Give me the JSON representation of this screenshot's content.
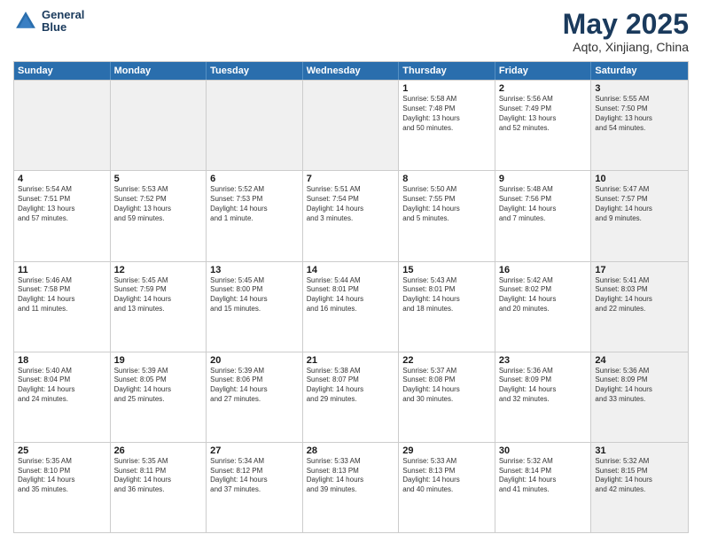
{
  "logo": {
    "line1": "General",
    "line2": "Blue"
  },
  "title": "May 2025",
  "location": "Aqto, Xinjiang, China",
  "headers": [
    "Sunday",
    "Monday",
    "Tuesday",
    "Wednesday",
    "Thursday",
    "Friday",
    "Saturday"
  ],
  "weeks": [
    [
      {
        "day": "",
        "text": "",
        "shaded": true
      },
      {
        "day": "",
        "text": "",
        "shaded": true
      },
      {
        "day": "",
        "text": "",
        "shaded": true
      },
      {
        "day": "",
        "text": "",
        "shaded": true
      },
      {
        "day": "1",
        "text": "Sunrise: 5:58 AM\nSunset: 7:48 PM\nDaylight: 13 hours\nand 50 minutes."
      },
      {
        "day": "2",
        "text": "Sunrise: 5:56 AM\nSunset: 7:49 PM\nDaylight: 13 hours\nand 52 minutes."
      },
      {
        "day": "3",
        "text": "Sunrise: 5:55 AM\nSunset: 7:50 PM\nDaylight: 13 hours\nand 54 minutes.",
        "shaded": true
      }
    ],
    [
      {
        "day": "4",
        "text": "Sunrise: 5:54 AM\nSunset: 7:51 PM\nDaylight: 13 hours\nand 57 minutes."
      },
      {
        "day": "5",
        "text": "Sunrise: 5:53 AM\nSunset: 7:52 PM\nDaylight: 13 hours\nand 59 minutes."
      },
      {
        "day": "6",
        "text": "Sunrise: 5:52 AM\nSunset: 7:53 PM\nDaylight: 14 hours\nand 1 minute."
      },
      {
        "day": "7",
        "text": "Sunrise: 5:51 AM\nSunset: 7:54 PM\nDaylight: 14 hours\nand 3 minutes."
      },
      {
        "day": "8",
        "text": "Sunrise: 5:50 AM\nSunset: 7:55 PM\nDaylight: 14 hours\nand 5 minutes."
      },
      {
        "day": "9",
        "text": "Sunrise: 5:48 AM\nSunset: 7:56 PM\nDaylight: 14 hours\nand 7 minutes."
      },
      {
        "day": "10",
        "text": "Sunrise: 5:47 AM\nSunset: 7:57 PM\nDaylight: 14 hours\nand 9 minutes.",
        "shaded": true
      }
    ],
    [
      {
        "day": "11",
        "text": "Sunrise: 5:46 AM\nSunset: 7:58 PM\nDaylight: 14 hours\nand 11 minutes."
      },
      {
        "day": "12",
        "text": "Sunrise: 5:45 AM\nSunset: 7:59 PM\nDaylight: 14 hours\nand 13 minutes."
      },
      {
        "day": "13",
        "text": "Sunrise: 5:45 AM\nSunset: 8:00 PM\nDaylight: 14 hours\nand 15 minutes."
      },
      {
        "day": "14",
        "text": "Sunrise: 5:44 AM\nSunset: 8:01 PM\nDaylight: 14 hours\nand 16 minutes."
      },
      {
        "day": "15",
        "text": "Sunrise: 5:43 AM\nSunset: 8:01 PM\nDaylight: 14 hours\nand 18 minutes."
      },
      {
        "day": "16",
        "text": "Sunrise: 5:42 AM\nSunset: 8:02 PM\nDaylight: 14 hours\nand 20 minutes."
      },
      {
        "day": "17",
        "text": "Sunrise: 5:41 AM\nSunset: 8:03 PM\nDaylight: 14 hours\nand 22 minutes.",
        "shaded": true
      }
    ],
    [
      {
        "day": "18",
        "text": "Sunrise: 5:40 AM\nSunset: 8:04 PM\nDaylight: 14 hours\nand 24 minutes."
      },
      {
        "day": "19",
        "text": "Sunrise: 5:39 AM\nSunset: 8:05 PM\nDaylight: 14 hours\nand 25 minutes."
      },
      {
        "day": "20",
        "text": "Sunrise: 5:39 AM\nSunset: 8:06 PM\nDaylight: 14 hours\nand 27 minutes."
      },
      {
        "day": "21",
        "text": "Sunrise: 5:38 AM\nSunset: 8:07 PM\nDaylight: 14 hours\nand 29 minutes."
      },
      {
        "day": "22",
        "text": "Sunrise: 5:37 AM\nSunset: 8:08 PM\nDaylight: 14 hours\nand 30 minutes."
      },
      {
        "day": "23",
        "text": "Sunrise: 5:36 AM\nSunset: 8:09 PM\nDaylight: 14 hours\nand 32 minutes."
      },
      {
        "day": "24",
        "text": "Sunrise: 5:36 AM\nSunset: 8:09 PM\nDaylight: 14 hours\nand 33 minutes.",
        "shaded": true
      }
    ],
    [
      {
        "day": "25",
        "text": "Sunrise: 5:35 AM\nSunset: 8:10 PM\nDaylight: 14 hours\nand 35 minutes."
      },
      {
        "day": "26",
        "text": "Sunrise: 5:35 AM\nSunset: 8:11 PM\nDaylight: 14 hours\nand 36 minutes."
      },
      {
        "day": "27",
        "text": "Sunrise: 5:34 AM\nSunset: 8:12 PM\nDaylight: 14 hours\nand 37 minutes."
      },
      {
        "day": "28",
        "text": "Sunrise: 5:33 AM\nSunset: 8:13 PM\nDaylight: 14 hours\nand 39 minutes."
      },
      {
        "day": "29",
        "text": "Sunrise: 5:33 AM\nSunset: 8:13 PM\nDaylight: 14 hours\nand 40 minutes."
      },
      {
        "day": "30",
        "text": "Sunrise: 5:32 AM\nSunset: 8:14 PM\nDaylight: 14 hours\nand 41 minutes."
      },
      {
        "day": "31",
        "text": "Sunrise: 5:32 AM\nSunset: 8:15 PM\nDaylight: 14 hours\nand 42 minutes.",
        "shaded": true
      }
    ]
  ]
}
